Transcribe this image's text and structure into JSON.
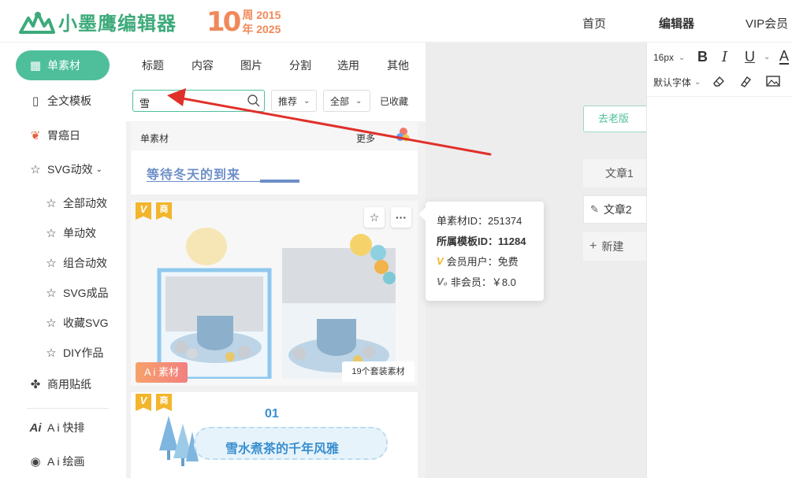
{
  "header": {
    "logo_text": "小墨鹰编辑器",
    "anniv_num": "10",
    "anniv_line1": "周 2015",
    "anniv_line2": "年 2025",
    "nav": [
      "首页",
      "编辑器",
      "VIP会员"
    ]
  },
  "sidebar": {
    "items": [
      {
        "label": "单素材",
        "icon": "grid-icon"
      },
      {
        "label": "全文模板",
        "icon": "layout-icon"
      },
      {
        "label": "胃癌日",
        "icon": "stomach-icon"
      },
      {
        "label": "SVG动效",
        "icon": "star-icon"
      },
      {
        "label": "全部动效",
        "icon": "star-icon"
      },
      {
        "label": "单动效",
        "icon": "star-icon"
      },
      {
        "label": "组合动效",
        "icon": "star-icon"
      },
      {
        "label": "SVG成品",
        "icon": "star-icon"
      },
      {
        "label": "收藏SVG",
        "icon": "star-icon"
      },
      {
        "label": "DIY作品",
        "icon": "star-icon"
      },
      {
        "label": "商用贴纸",
        "icon": "puzzle-icon"
      },
      {
        "label": "A i 快排",
        "icon": "ai-icon"
      },
      {
        "label": "A i 绘画",
        "icon": "palette-icon"
      }
    ]
  },
  "panel": {
    "tabs": [
      "标题",
      "内容",
      "图片",
      "分割",
      "选用",
      "其他"
    ],
    "search": {
      "value": "雪"
    },
    "filter_recommend": "推荐",
    "filter_all": "全部",
    "favorites": "已收藏",
    "section_title": "单素材",
    "section_more": "更多",
    "card1_text": "等待冬天的到来",
    "badge_v": "V",
    "badge_shang": "商",
    "ai_tag": "A i 素材",
    "count_tag": "19个套装素材",
    "card3_num": "01",
    "card3_text": "雪水煮茶的千年风雅"
  },
  "popup": {
    "material_id": "单素材ID：251374",
    "template_id": "所属模板ID：11284",
    "member": "会员用户：免费",
    "nonmember": "非会员：￥8.0"
  },
  "canvas": {
    "old_version": "去老版",
    "doc_tabs": [
      "文章1",
      "文章2",
      "新建"
    ]
  },
  "toolbar": {
    "font_size": "16px",
    "font_family": "默认字体",
    "bold": "B",
    "italic": "I",
    "underline": "U",
    "color_a": "A"
  },
  "colors": {
    "brand": "#4fbf9b",
    "accent_orange": "#f0895a",
    "badge_gold": "#f2b52b",
    "annotation_red": "#e0302a"
  }
}
